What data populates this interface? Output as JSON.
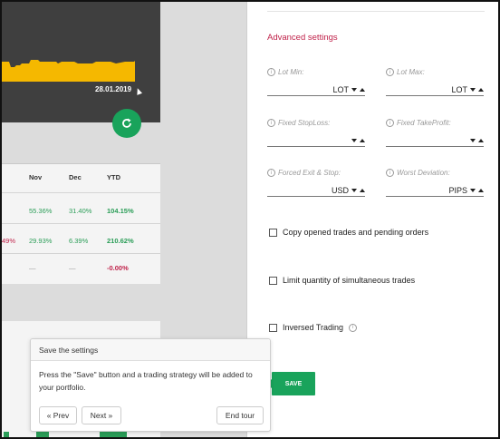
{
  "chart": {
    "date_label": "28.01.2019"
  },
  "table": {
    "headers": [
      "Nov",
      "Dec",
      "YTD"
    ],
    "rows": [
      {
        "partial": "",
        "nov": "55.36%",
        "dec": "31.40%",
        "ytd": "104.15%"
      },
      {
        "partial": "49%",
        "nov": "29.93%",
        "dec": "6.39%",
        "ytd": "210.62%"
      },
      {
        "partial": "",
        "nov": "—",
        "dec": "—",
        "ytd": "-0.00%"
      }
    ]
  },
  "settings": {
    "title": "Advanced settings",
    "fields": {
      "lot_min": {
        "label": "Lot Min:",
        "value": "LOT"
      },
      "lot_max": {
        "label": "Lot Max:",
        "value": "LOT"
      },
      "fixed_stoploss": {
        "label": "Fixed StopLoss:",
        "value": ""
      },
      "fixed_takeprofit": {
        "label": "Fixed TakeProfit:",
        "value": ""
      },
      "forced_exit": {
        "label": "Forced Exit & Stop:",
        "value": "USD"
      },
      "worst_deviation": {
        "label": "Worst Deviation:",
        "value": "PIPS"
      }
    },
    "checkboxes": {
      "copy_opened": "Copy opened trades and pending orders",
      "limit_quantity": "Limit quantity of simultaneous trades",
      "inversed_trading": "Inversed Trading"
    },
    "save_label": "SAVE"
  },
  "tour": {
    "title": "Save the settings",
    "body": "Press the \"Save\" button and a trading strategy will be added to your portfolio.",
    "prev_label": "« Prev",
    "next_label": "Next »",
    "end_label": "End tour"
  },
  "colors": {
    "accent_green": "#19a35b",
    "accent_red": "#c0224a",
    "chart_fill": "#f5b800"
  }
}
